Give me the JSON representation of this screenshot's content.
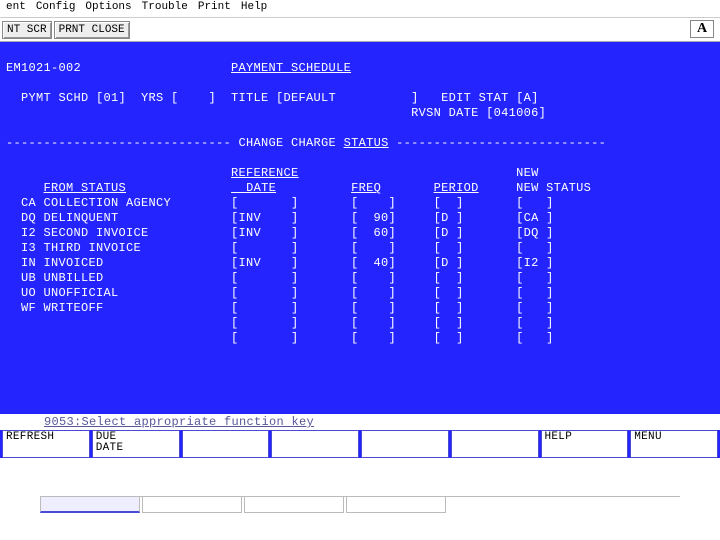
{
  "menubar": [
    "ent",
    "Config",
    "Options",
    "Trouble",
    "Print",
    "Help"
  ],
  "toolbar": {
    "btn1": "NT SCR",
    "btn2": "PRNT CLOSE",
    "font_indicator": "A"
  },
  "screen": {
    "screen_id": "EM1021-002",
    "title": "PAYMENT SCHEDULE",
    "pymt_schd_label": "PYMT SCHD",
    "pymt_schd_val": "[01]",
    "yrs_label": "YRS",
    "yrs_val": "[    ]",
    "title_label": "TITLE",
    "title_val": "[DEFAULT          ]",
    "edit_stat_label": "EDIT STAT",
    "edit_stat_val": "[A]",
    "rvsn_label": "RVSN DATE",
    "rvsn_val": "[041006]",
    "section_header": "CHANGE CHARGE STATUS",
    "col_from": "FROM STATUS",
    "col_ref": "REFERENCE DATE",
    "col_freq": "FREQ",
    "col_period": "PERIOD",
    "col_new": "NEW STATUS",
    "rows": [
      {
        "code": "CA",
        "desc": "COLLECTION AGENCY",
        "ref": "[       ]",
        "freq": "[    ]",
        "period": "[  ]",
        "new": "[   ]"
      },
      {
        "code": "DQ",
        "desc": "DELINQUENT",
        "ref": "[INV    ]",
        "freq": "[  90]",
        "period": "[D ]",
        "new": "[CA ]"
      },
      {
        "code": "I2",
        "desc": "SECOND INVOICE",
        "ref": "[INV    ]",
        "freq": "[  60]",
        "period": "[D ]",
        "new": "[DQ ]"
      },
      {
        "code": "I3",
        "desc": "THIRD INVOICE",
        "ref": "[       ]",
        "freq": "[    ]",
        "period": "[  ]",
        "new": "[   ]"
      },
      {
        "code": "IN",
        "desc": "INVOICED",
        "ref": "[INV    ]",
        "freq": "[  40]",
        "period": "[D ]",
        "new": "[I2 ]"
      },
      {
        "code": "UB",
        "desc": "UNBILLED",
        "ref": "[       ]",
        "freq": "[    ]",
        "period": "[  ]",
        "new": "[   ]"
      },
      {
        "code": "UO",
        "desc": "UNOFFICIAL",
        "ref": "[       ]",
        "freq": "[    ]",
        "period": "[  ]",
        "new": "[   ]"
      },
      {
        "code": "WF",
        "desc": "WRITEOFF",
        "ref": "[       ]",
        "freq": "[    ]",
        "period": "[  ]",
        "new": "[   ]"
      },
      {
        "code": "  ",
        "desc": "",
        "ref": "[       ]",
        "freq": "[    ]",
        "period": "[  ]",
        "new": "[   ]"
      },
      {
        "code": "  ",
        "desc": "",
        "ref": "[       ]",
        "freq": "[    ]",
        "period": "[  ]",
        "new": "[   ]"
      }
    ],
    "status_msg": "9053:Select appropriate function key"
  },
  "fn_keys": [
    "REFRESH",
    "DUE\nDATE",
    "",
    "",
    "",
    "",
    "HELP",
    "MENU"
  ]
}
